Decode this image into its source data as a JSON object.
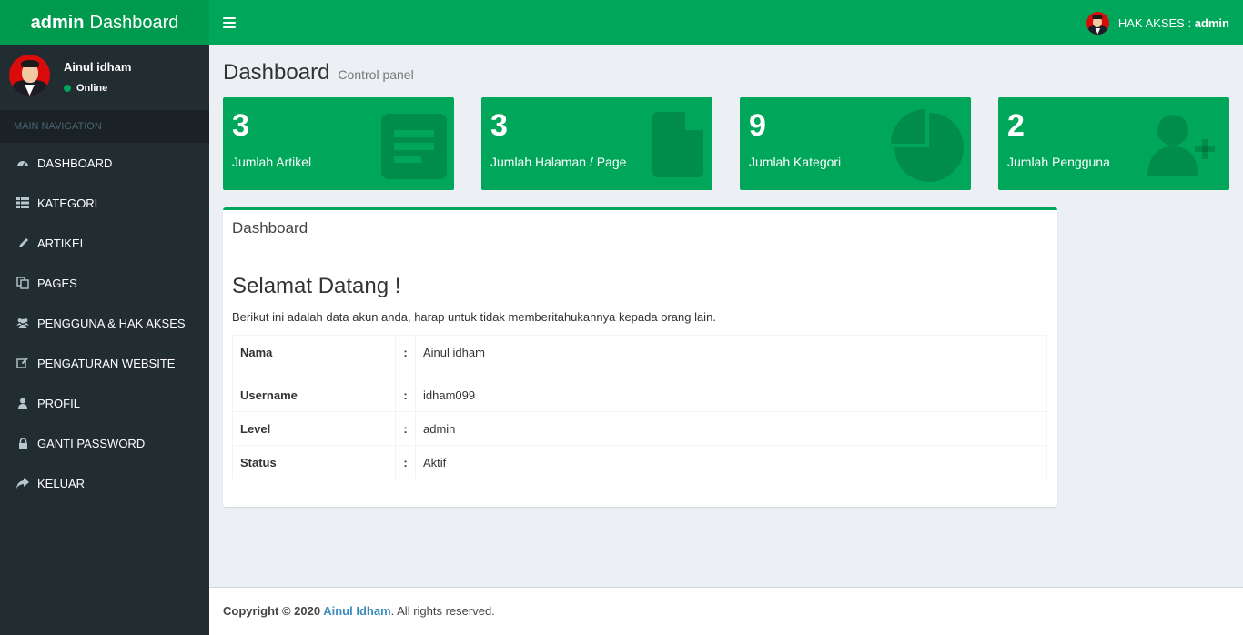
{
  "app": {
    "logo_bold": "admin",
    "logo_rest": "Dashboard"
  },
  "navbar": {
    "access_label": "HAK AKSES : ",
    "access_value": "admin"
  },
  "user": {
    "name": "Ainul idham",
    "status": "Online"
  },
  "sidebar": {
    "header": "MAIN NAVIGATION",
    "items": [
      {
        "label": "DASHBOARD",
        "icon": "dashboard-icon"
      },
      {
        "label": "KATEGORI",
        "icon": "grid-icon"
      },
      {
        "label": "ARTIKEL",
        "icon": "pencil-icon"
      },
      {
        "label": "PAGES",
        "icon": "copy-icon"
      },
      {
        "label": "PENGGUNA & HAK AKSES",
        "icon": "users-icon"
      },
      {
        "label": "PENGATURAN WEBSITE",
        "icon": "edit-icon"
      },
      {
        "label": "PROFIL",
        "icon": "user-icon"
      },
      {
        "label": "GANTI PASSWORD",
        "icon": "lock-icon"
      },
      {
        "label": "KELUAR",
        "icon": "share-icon"
      }
    ]
  },
  "page": {
    "title": "Dashboard",
    "subtitle": "Control panel"
  },
  "stats": [
    {
      "value": "3",
      "label": "Jumlah Artikel",
      "icon": "list-icon"
    },
    {
      "value": "3",
      "label": "Jumlah Halaman / Page",
      "icon": "file-icon"
    },
    {
      "value": "9",
      "label": "Jumlah Kategori",
      "icon": "pie-chart-icon"
    },
    {
      "value": "2",
      "label": "Jumlah Pengguna",
      "icon": "user-plus-icon"
    }
  ],
  "panel": {
    "title": "Dashboard",
    "welcome": "Selamat Datang !",
    "intro": "Berikut ini adalah data akun anda, harap untuk tidak memberitahukannya kepada orang lain.",
    "rows": [
      {
        "label": "Nama",
        "colon": ":",
        "value": "Ainul idham"
      },
      {
        "label": "Username",
        "colon": ":",
        "value": "idham099"
      },
      {
        "label": "Level",
        "colon": ":",
        "value": "admin"
      },
      {
        "label": "Status",
        "colon": ":",
        "value": "Aktif"
      }
    ]
  },
  "footer": {
    "prefix": "Copyright © 2020 ",
    "author": "Ainul Idham",
    "suffix": ". All rights reserved."
  },
  "colors": {
    "primary": "#00a65a",
    "logo_bg": "#009a4e",
    "sidebar_bg": "#222d32",
    "content_bg": "#ecf0f5"
  }
}
